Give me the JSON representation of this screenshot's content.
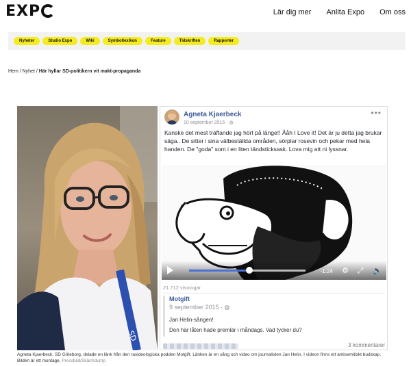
{
  "header": {
    "logo": "EXP",
    "nav": [
      "Lär dig mer",
      "Anlita Expo",
      "Om oss"
    ]
  },
  "categories": [
    "Nyheter",
    "Studio Expo",
    "Wiki",
    "Symbollexikon",
    "Feature",
    "Tidskriften",
    "Rapporter"
  ],
  "breadcrumb": {
    "home": "Hem",
    "sep": " / ",
    "section": "Nyhet",
    "current": "Här hyllar SD-politikern vit makt-propaganda"
  },
  "facebook_post": {
    "author": "Agneta Kjaerbeck",
    "date": "10 september 2015 · ",
    "more": "•••",
    "text": "Kanske det mest träffande jag hört på länge!! Ååh I Love it! Det är ju detta jag brukar säga.. De sitter i sina välbeställda områden, sörplar rosevin och pekar med hela handen. De \"goda\" som i en liten tändsticksask. Lova mig att ni lyssnar.",
    "video_time": "-1:24",
    "video_progress": 0.52,
    "views": "21 712 visningar",
    "shared": {
      "author": "Motgift",
      "date": "9 september 2015 · ",
      "title": "Jan Helin-sången!",
      "text": "Den här låten hade premiär i måndags. Vad tycker du?"
    },
    "comments": "3 kommentarer"
  },
  "caption": {
    "text": "Agneta Kjaerbeck, SD Göteborg, delade en länk från den rasideologiska podden Motgift. Länken är en sång och video om journalisten Jan Helin. I videon finns ett antisemitiskt budskap. Bilden är ett montage. ",
    "credit": "Pressbild/Skärmdump"
  },
  "colors": {
    "accent_yellow": "#f5ec1f",
    "fb_blue": "#3b5998",
    "progress_blue": "#4a6fd6"
  }
}
